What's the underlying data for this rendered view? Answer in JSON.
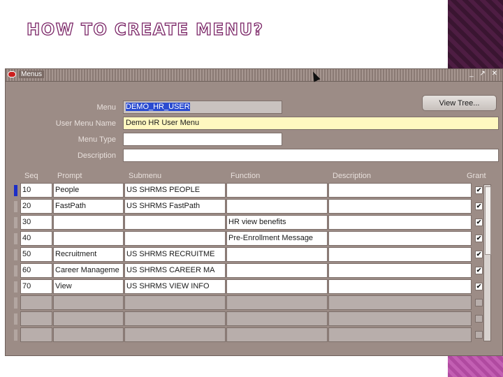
{
  "slide": {
    "title": "HOW TO CREATE MENU?"
  },
  "window": {
    "title": "Menus",
    "controls": "_ ↗ ✕"
  },
  "form": {
    "menu_label": "Menu",
    "menu_value": "DEMO_HR_USER",
    "user_menu_name_label": "User Menu Name",
    "user_menu_name_value": "Demo HR User Menu",
    "menu_type_label": "Menu Type",
    "menu_type_value": "",
    "description_label": "Description",
    "description_value": "",
    "view_tree_label": "View Tree..."
  },
  "table": {
    "headers": {
      "seq": "Seq",
      "prompt": "Prompt",
      "submenu": "Submenu",
      "function": "Function",
      "description": "Description",
      "grant": "Grant"
    },
    "rows": [
      {
        "seq": "10",
        "prompt": "People",
        "submenu": "US SHRMS PEOPLE",
        "function": "",
        "description": "",
        "grant": "✔"
      },
      {
        "seq": "20",
        "prompt": "FastPath",
        "submenu": "US SHRMS FastPath",
        "function": "",
        "description": "",
        "grant": "✔"
      },
      {
        "seq": "30",
        "prompt": "",
        "submenu": "",
        "function": "HR view benefits",
        "description": "",
        "grant": "✔"
      },
      {
        "seq": "40",
        "prompt": "",
        "submenu": "",
        "function": "Pre-Enrollment Message",
        "description": "",
        "grant": "✔"
      },
      {
        "seq": "50",
        "prompt": "Recruitment",
        "submenu": "US SHRMS RECRUITME",
        "function": "",
        "description": "",
        "grant": "✔"
      },
      {
        "seq": "60",
        "prompt": "Career Manageme",
        "submenu": "US SHRMS CAREER MA",
        "function": "",
        "description": "",
        "grant": "✔"
      },
      {
        "seq": "70",
        "prompt": "View",
        "submenu": "US SHRMS VIEW INFO",
        "function": "",
        "description": "",
        "grant": "✔"
      },
      {
        "seq": "",
        "prompt": "",
        "submenu": "",
        "function": "",
        "description": "",
        "grant": ""
      },
      {
        "seq": "",
        "prompt": "",
        "submenu": "",
        "function": "",
        "description": "",
        "grant": ""
      },
      {
        "seq": "",
        "prompt": "",
        "submenu": "",
        "function": "",
        "description": "",
        "grant": ""
      }
    ]
  },
  "colors": {
    "accent_title": "#7a2466",
    "selection": "#2a4bd0",
    "window_bg": "#9c8c86",
    "required_field": "#fff8c0"
  }
}
